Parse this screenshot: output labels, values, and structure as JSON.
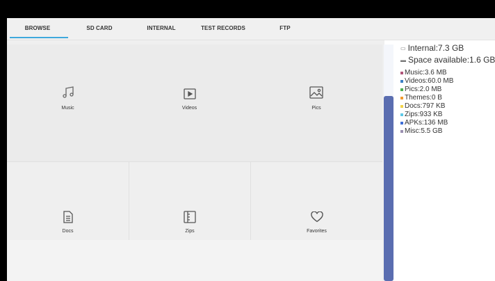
{
  "tabs": [
    {
      "label": "BROWSE",
      "active": true
    },
    {
      "label": "SD CARD",
      "active": false
    },
    {
      "label": "INTERNAL",
      "active": false
    },
    {
      "label": "TEST RECORDS",
      "active": false
    },
    {
      "label": "FTP",
      "active": false
    }
  ],
  "categories": [
    {
      "label": "Music",
      "icon": "music-note-icon"
    },
    {
      "label": "Videos",
      "icon": "video-play-icon"
    },
    {
      "label": "Pics",
      "icon": "image-icon"
    },
    {
      "label": "Docs",
      "icon": "document-icon"
    },
    {
      "label": "Zips",
      "icon": "archive-icon"
    },
    {
      "label": "Favorites",
      "icon": "heart-icon"
    }
  ],
  "storage": {
    "internal": "Internal:7.3 GB",
    "space_available": "Space available:1.6 GB",
    "items": [
      {
        "label": "Music:3.6 MB",
        "color": "#b0567a"
      },
      {
        "label": "Videos:60.0 MB",
        "color": "#3a7fc4"
      },
      {
        "label": "Pics:2.0 MB",
        "color": "#4caf50"
      },
      {
        "label": "Themes:0 B",
        "color": "#f29b2e"
      },
      {
        "label": "Docs:797 KB",
        "color": "#f2d44a"
      },
      {
        "label": "Zips:933 KB",
        "color": "#5ec9e8"
      },
      {
        "label": "APKs:136 MB",
        "color": "#3f6fd8"
      },
      {
        "label": "Misc:5.5 GB",
        "color": "#9a8fb0"
      }
    ]
  },
  "colors": {
    "tab_indicator": "#3ea8dc",
    "scroll_thumb": "#5a6db0"
  }
}
